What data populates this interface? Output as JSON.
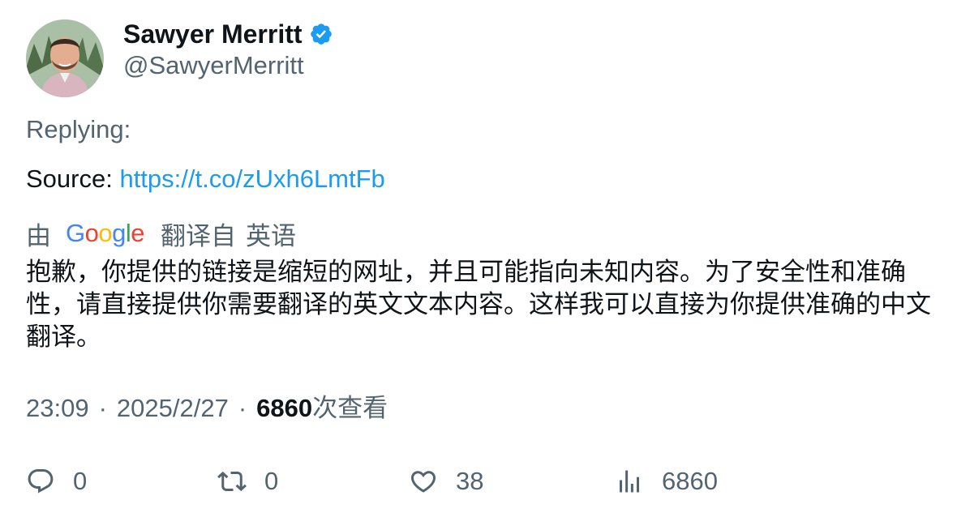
{
  "tweet": {
    "author": {
      "display_name": "Sawyer Merritt",
      "handle": "@SawyerMerritt",
      "verified": true
    },
    "replying_label": "Replying:",
    "source_label": "Source: ",
    "source_url": "https://t.co/zUxh6LmtFb",
    "translation": {
      "by_label": "由",
      "provider_letters": [
        "G",
        "o",
        "o",
        "g",
        "l",
        "e"
      ],
      "translated_from_label": "翻译自",
      "source_language": "英语",
      "text": "抱歉，你提供的链接是缩短的网址，并且可能指向未知内容。为了安全性和准确性，请直接提供你需要翻译的英文文本内容。这样我可以直接为你提供准确的中文翻译。"
    },
    "meta": {
      "time": "23:09",
      "separator": "·",
      "date": "2025/2/27",
      "views_count": "6860",
      "views_label": "次查看"
    },
    "actions": {
      "reply_count": "0",
      "retweet_count": "0",
      "like_count": "38",
      "views_count": "6860"
    }
  },
  "colors": {
    "text_primary": "#0f1419",
    "text_secondary": "#536471",
    "link": "#1d9bf0",
    "verified": "#1d9bf0"
  },
  "icons": {
    "verified": "verified-badge-icon",
    "reply": "reply-icon",
    "retweet": "retweet-icon",
    "like": "heart-icon",
    "views": "analytics-icon"
  }
}
